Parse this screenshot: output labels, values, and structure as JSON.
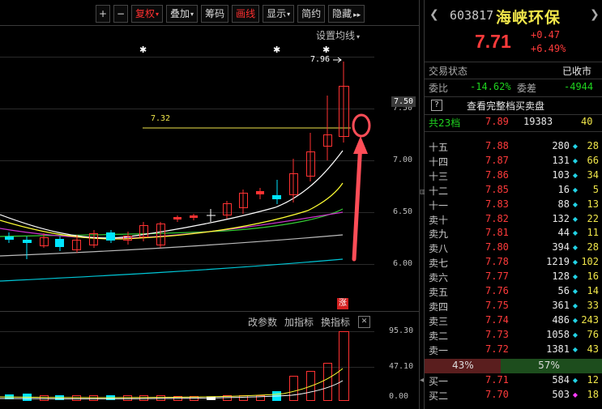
{
  "toolbar": {
    "items": [
      {
        "label": "+",
        "kind": "zoom-in"
      },
      {
        "label": "−",
        "kind": "zoom-out"
      },
      {
        "label": "复权",
        "dropdown": true,
        "color": "#ff3030"
      },
      {
        "label": "叠加",
        "dropdown": true
      },
      {
        "label": "筹码"
      },
      {
        "label": "画线",
        "color": "#ff3030"
      },
      {
        "label": "显示",
        "dropdown": true
      },
      {
        "label": "简约"
      },
      {
        "label": "隐藏",
        "suffix": "▸▸"
      }
    ],
    "settings_ma": "设置均线"
  },
  "chart": {
    "y_ticks": [
      "7.50",
      "7.00",
      "6.50",
      "6.00"
    ],
    "current_price_tag": "7.50",
    "high_label": "7.96",
    "level_line_label": "7.32",
    "limit_up_badge": "涨",
    "star_glyph": "✱",
    "colors": {
      "up": "#ff3232",
      "down": "#00e5ff",
      "ma5": "#ffffff",
      "ma10": "#ffff33",
      "ma20": "#cc33cc",
      "ma30": "#33cc33",
      "ma60": "#bbbbbb",
      "ma120": "#00c8d8",
      "highlight": "#ff4d57"
    }
  },
  "indicator": {
    "buttons": [
      "改参数",
      "加指标",
      "换指标"
    ],
    "close_glyph": "✕",
    "y_ticks": [
      "95.30",
      "47.10",
      "0.00"
    ]
  },
  "stock": {
    "code": "603817",
    "name": "海峡环保",
    "price": "7.71",
    "change": "+0.47",
    "change_pct": "+6.49%",
    "nav_left": "❮",
    "nav_right": "❯"
  },
  "status": {
    "label": "交易状态",
    "value": "已收市"
  },
  "ratio": {
    "label1": "委比",
    "value1": "-14.62%",
    "label2": "委差",
    "value2": "-4944"
  },
  "full_depth": {
    "icon": "?",
    "label": "查看完整档买卖盘"
  },
  "summary": {
    "label": "共23档",
    "price": "7.89",
    "volume": "19383",
    "count": "40"
  },
  "asks": [
    {
      "label": "十五",
      "price": "7.88",
      "volume": "280",
      "count": "28",
      "marker": "◆"
    },
    {
      "label": "十四",
      "price": "7.87",
      "volume": "131",
      "count": "66",
      "marker": "◆"
    },
    {
      "label": "十三",
      "price": "7.86",
      "volume": "103",
      "count": "34",
      "marker": "◆"
    },
    {
      "label": "十二",
      "price": "7.85",
      "volume": "16",
      "count": "5",
      "marker": "◆"
    },
    {
      "label": "十一",
      "price": "7.83",
      "volume": "88",
      "count": "13",
      "marker": "◆"
    },
    {
      "label": "卖十",
      "price": "7.82",
      "volume": "132",
      "count": "22",
      "marker": "◆"
    },
    {
      "label": "卖九",
      "price": "7.81",
      "volume": "44",
      "count": "11",
      "marker": "◆"
    },
    {
      "label": "卖八",
      "price": "7.80",
      "volume": "394",
      "count": "28",
      "marker": "◆"
    },
    {
      "label": "卖七",
      "price": "7.78",
      "volume": "1219",
      "count": "102",
      "marker": "◆"
    },
    {
      "label": "卖六",
      "price": "7.77",
      "volume": "128",
      "count": "16",
      "marker": "◆"
    },
    {
      "label": "卖五",
      "price": "7.76",
      "volume": "56",
      "count": "14",
      "marker": "◆"
    },
    {
      "label": "卖四",
      "price": "7.75",
      "volume": "361",
      "count": "33",
      "marker": "◆"
    },
    {
      "label": "卖三",
      "price": "7.74",
      "volume": "486",
      "count": "243",
      "marker": "◆"
    },
    {
      "label": "卖二",
      "price": "7.73",
      "volume": "1058",
      "count": "76",
      "marker": "◆"
    },
    {
      "label": "卖一",
      "price": "7.72",
      "volume": "1381",
      "count": "43",
      "marker": "◆"
    }
  ],
  "ratio_bar": {
    "sell_pct": "43%",
    "buy_pct": "57%",
    "sell_fraction": 0.43,
    "buy_fraction": 0.57
  },
  "bids": [
    {
      "label": "买一",
      "price": "7.71",
      "volume": "584",
      "count": "12",
      "marker": "◆"
    },
    {
      "label": "买二",
      "price": "7.70",
      "volume": "503",
      "count": "18",
      "marker": "◆"
    }
  ]
}
